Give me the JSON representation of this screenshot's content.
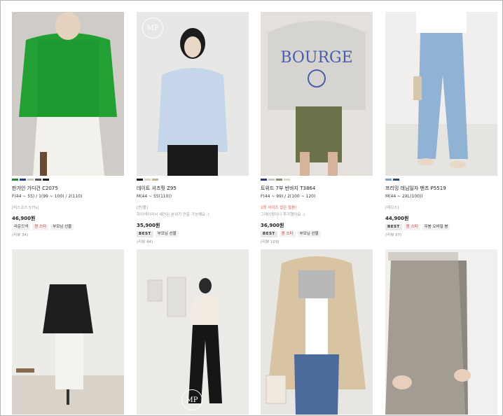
{
  "products": [
    {
      "name": "핀가인 가디건 C2075",
      "size": "F(44 ~ 55) / 1(99 ~ 100) / 2(110)",
      "note": "[비스코스 57%]",
      "price": "46,900원",
      "badges": [
        {
          "label": "라운드넥",
          "kind": "plain"
        },
        {
          "label": "원 스타",
          "kind": "red"
        },
        {
          "label": "부모님 선물",
          "kind": "plain"
        }
      ],
      "review": "(리뷰 34)",
      "swatches": [
        "#1b8a2e",
        "#2c3e88",
        "#c9c6bf",
        "#555555",
        "#1a1a1a"
      ]
    },
    {
      "name": "데이트 셔츠핏 Z95",
      "size": "M(44 ~ 55(110))",
      "note": "[면/폴]",
      "note2": "하이넥이라서 세련된 분위기 연출 가능해요 :)",
      "price": "35,900원",
      "badges": [
        {
          "label": "BEST",
          "kind": "best"
        },
        {
          "label": "부모님 선물",
          "kind": "plain"
        }
      ],
      "review": "(리뷰 44)",
      "swatches": [
        "#1a1a1a",
        "#d8d4c8",
        "#c7b08c"
      ]
    },
    {
      "name": "트위드 7부 반바지 T3864",
      "size": "F(44 ~ 99) / 2(100 ~ 120)",
      "note": "2장 사이즈 업은 않음!",
      "note2": "그레이핏이나 추가했어요 :)",
      "price": "36,900원",
      "badges": [
        {
          "label": "BEST",
          "kind": "best"
        },
        {
          "label": "원 스타",
          "kind": "red"
        },
        {
          "label": "부모님 선물",
          "kind": "plain"
        }
      ],
      "review": "(리뷰 103)",
      "swatches": [
        "#2b3a7a",
        "#c8c8c8",
        "#8a8f6e",
        "#e0d8c8"
      ]
    },
    {
      "name": "프리밍 데님일자 팬츠 P5519",
      "size": "M(44 ~ 2XL(100))",
      "note": "[레깅스]",
      "price": "44,900원",
      "badges": [
        {
          "label": "BEST",
          "kind": "best"
        },
        {
          "label": "원 스타",
          "kind": "red"
        },
        {
          "label": "무봉 오바밀 봉",
          "kind": "plain"
        }
      ],
      "review": "(리뷰 97)",
      "swatches": [
        "#7f9fc4",
        "#2c4a7a"
      ]
    }
  ],
  "brand_logo": "MP",
  "colors": {
    "border": "#b5b5b5",
    "note_red": "#e0503a",
    "badge_bg": "#f3f3f3"
  },
  "icons": [
    "brand-logo-icon"
  ]
}
